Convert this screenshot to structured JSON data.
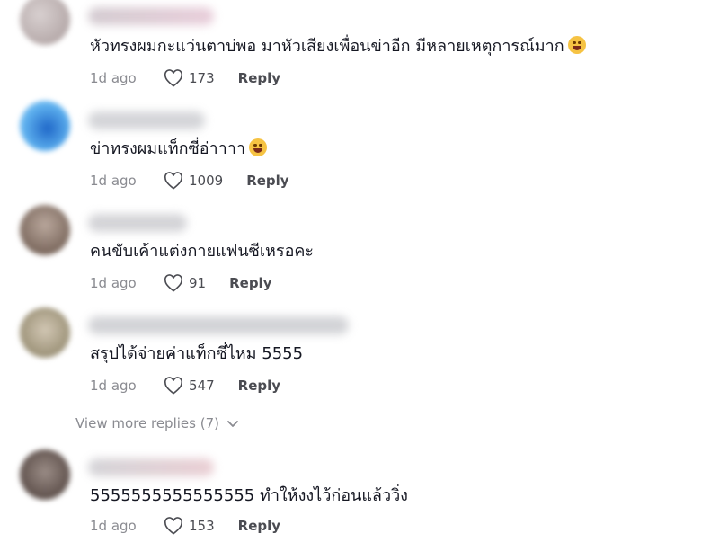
{
  "comments": [
    {
      "text": "หัวทรงผมกะแว่นตาบ่พอ มาหัวเสียงเพื่อนข่าอีก มีหลายเหตุการณ์มาก",
      "emoji": "laughing-tears-emoji",
      "time": "1d ago",
      "likes": "173",
      "reply": "Reply"
    },
    {
      "text": "ข่าทรงผมแท็กซี่อ่าาาา",
      "emoji": "sweat-smile-emoji",
      "time": "1d ago",
      "likes": "1009",
      "reply": "Reply"
    },
    {
      "text": "คนขับเค้าแต่งกายแฟนซีเหรอคะ",
      "time": "1d ago",
      "likes": "91",
      "reply": "Reply"
    },
    {
      "text": "สรุปได้จ่ายค่าแท็กซี่ไหม 5555",
      "time": "1d ago",
      "likes": "547",
      "reply": "Reply"
    },
    {
      "text": "5555555555555555 ทำให้งงไว้ก่อนแล้ววิ่ง",
      "time": "1d ago",
      "likes": "153",
      "reply": "Reply"
    }
  ],
  "view_more": "View more replies (7)",
  "colors": {
    "text": "#161823",
    "muted": "#8a8b91"
  }
}
